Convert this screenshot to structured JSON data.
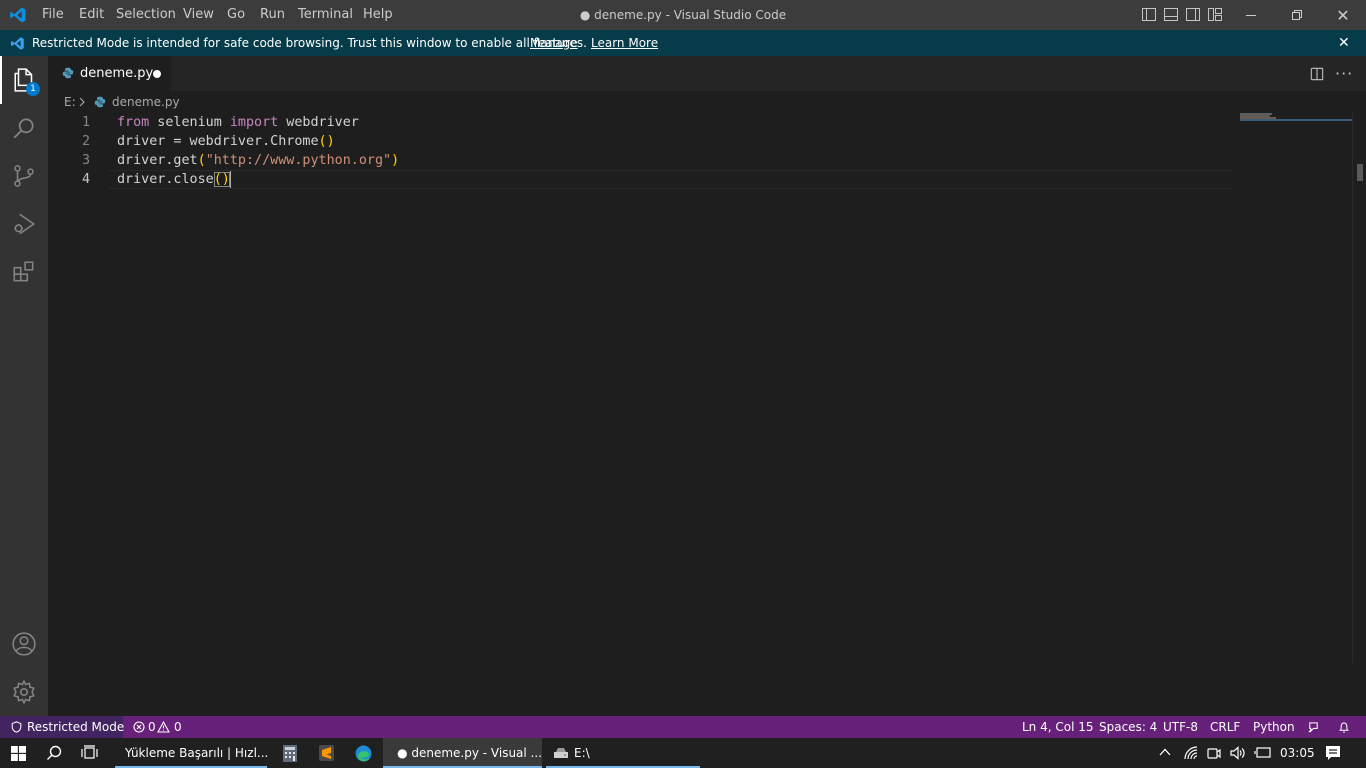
{
  "titlebar": {
    "menu": [
      "File",
      "Edit",
      "Selection",
      "View",
      "Go",
      "Run",
      "Terminal",
      "Help"
    ],
    "title": "● deneme.py - Visual Studio Code",
    "window_controls": [
      "minimize-icon",
      "restore-icon",
      "close-icon"
    ],
    "layout_toggles": [
      "toggle-primary-sidebar-icon",
      "toggle-panel-icon",
      "toggle-secondary-sidebar-icon",
      "customize-layout-icon"
    ]
  },
  "banner": {
    "text": "Restricted Mode is intended for safe code browsing. Trust this window to enable all features.",
    "manage": "Manage",
    "learn_more": "Learn More"
  },
  "activity_bar": {
    "explorer_badge": "1",
    "items": [
      "files-icon",
      "search-icon",
      "source-control-icon",
      "run-debug-icon",
      "extensions-icon"
    ],
    "bottom": [
      "account-icon",
      "gear-icon"
    ]
  },
  "tabs": [
    {
      "label": "deneme.py",
      "modified": true
    }
  ],
  "breadcrumb": {
    "drive": "E:",
    "file": "deneme.py"
  },
  "editor": {
    "lines": [
      {
        "num": "1",
        "text": "from selenium import webdriver"
      },
      {
        "num": "2",
        "text": "driver = webdriver.Chrome()"
      },
      {
        "num": "3",
        "text": "driver.get(\"http://www.python.org\")"
      },
      {
        "num": "4",
        "text": "driver.close()"
      }
    ],
    "tokens": {
      "l1_kw1": "from",
      "l1_mod": " selenium ",
      "l1_kw2": "import",
      "l1_rest": " webdriver",
      "l2_a": "driver = webdriver.Chrome",
      "l2_b": "()",
      "l3_a": "driver.get",
      "l3_open": "(",
      "l3_str": "\"http://www.python.org\"",
      "l3_close": ")",
      "l4_a": "driver.close",
      "l4_b": "()"
    }
  },
  "statusbar": {
    "restricted": "Restricted Mode",
    "errors": "0",
    "warnings": "0",
    "position": "Ln 4, Col 15",
    "spaces": "Spaces: 4",
    "encoding": "UTF-8",
    "eol": "CRLF",
    "language": "Python"
  },
  "taskbar": {
    "chrome_label": "Yükleme Başarılı | Hızl...",
    "vscode_label": "● deneme.py - Visual ...",
    "explorer_label": "E:\\",
    "time": "03:05"
  },
  "colors": {
    "statusbar": "#68217a",
    "banner": "#063b49",
    "accent": "#007acc"
  }
}
